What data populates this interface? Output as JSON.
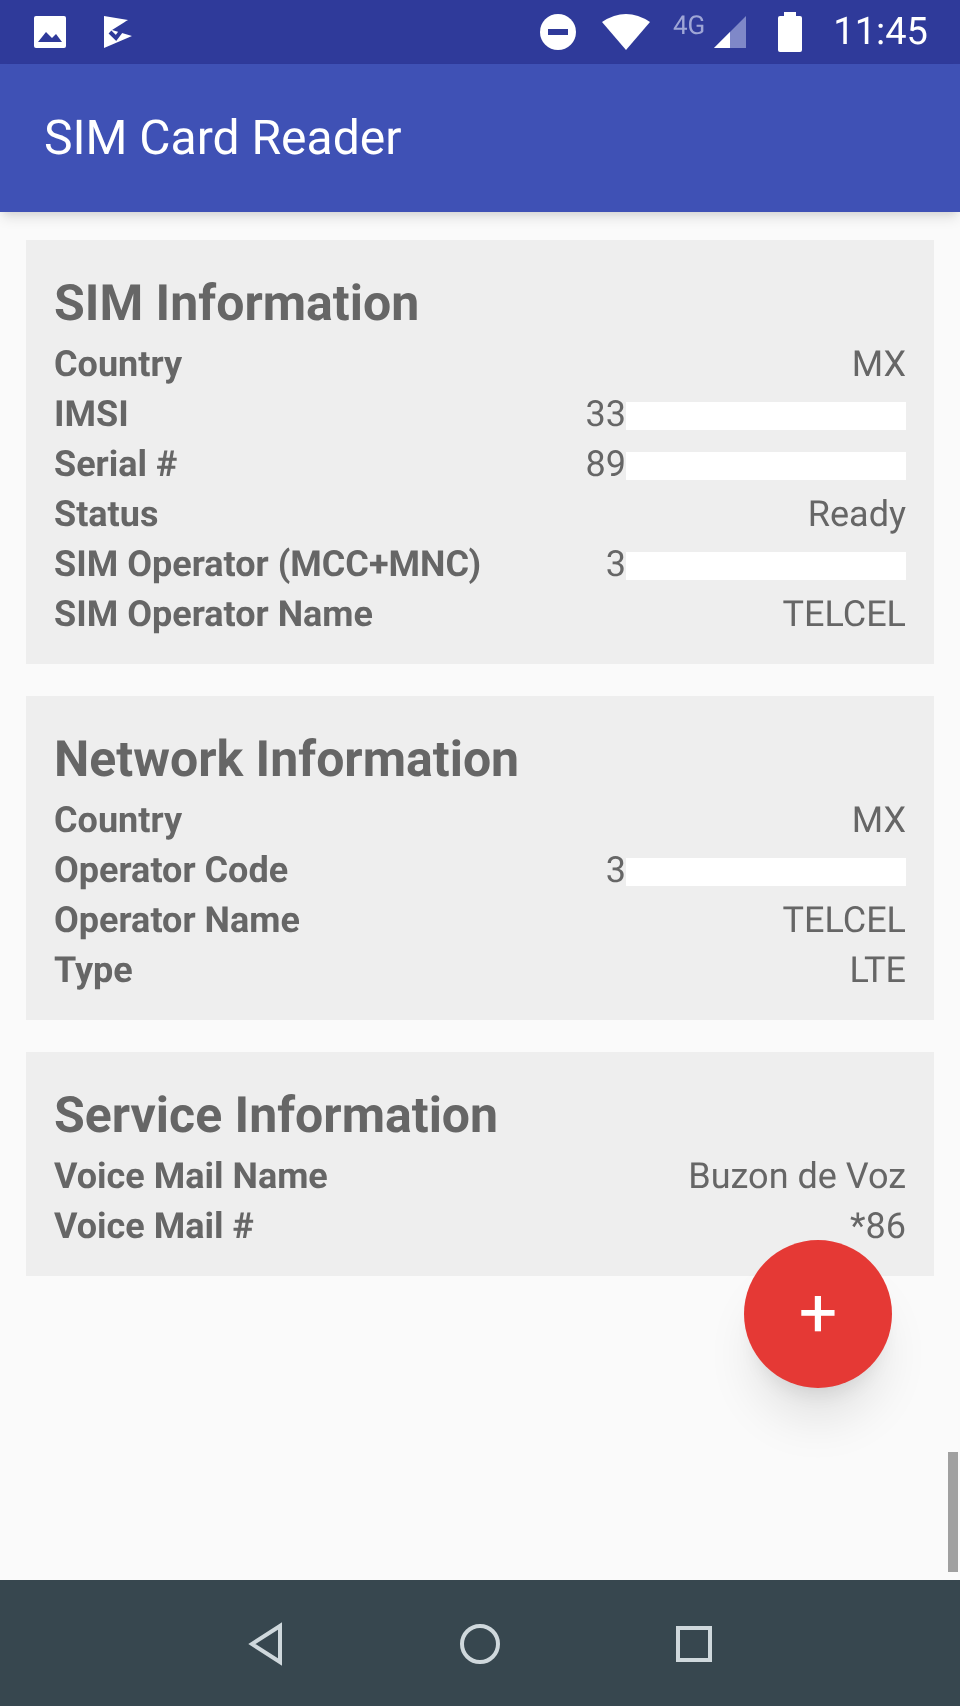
{
  "status_bar": {
    "network": "4G",
    "time": "11:45"
  },
  "app_bar": {
    "title": "SIM Card Reader"
  },
  "sections": [
    {
      "title": "SIM Information",
      "rows": [
        {
          "label": "Country",
          "value": "MX"
        },
        {
          "label": "IMSI",
          "value": "33",
          "redacted": true
        },
        {
          "label": "Serial #",
          "value": "89",
          "redacted": true
        },
        {
          "label": "Status",
          "value": "Ready"
        },
        {
          "label": "SIM Operator (MCC+MNC)",
          "value": "3",
          "redacted": true
        },
        {
          "label": "SIM Operator Name",
          "value": "TELCEL"
        }
      ]
    },
    {
      "title": "Network Information",
      "rows": [
        {
          "label": "Country",
          "value": "MX"
        },
        {
          "label": "Operator Code",
          "value": "3",
          "redacted": true
        },
        {
          "label": "Operator Name",
          "value": "TELCEL"
        },
        {
          "label": "Type",
          "value": "LTE"
        }
      ]
    },
    {
      "title": "Service Information",
      "rows": [
        {
          "label": "Voice Mail Name",
          "value": "Buzon de Voz"
        },
        {
          "label": "Voice Mail #",
          "value": "*86"
        }
      ]
    }
  ],
  "fab": {
    "label": "+"
  }
}
